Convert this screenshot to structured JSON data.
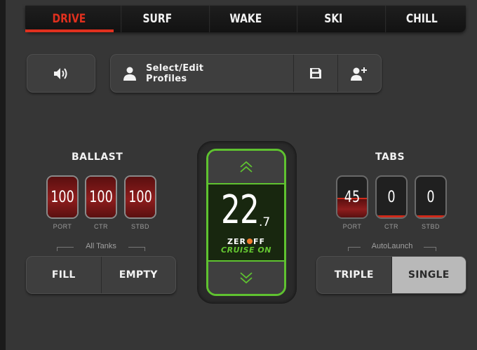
{
  "tabs": [
    {
      "label": "DRIVE",
      "active": true
    },
    {
      "label": "SURF",
      "active": false
    },
    {
      "label": "WAKE",
      "active": false
    },
    {
      "label": "SKI",
      "active": false
    },
    {
      "label": "CHILL",
      "active": false
    }
  ],
  "toolbar": {
    "volume_icon": "speaker-volume-icon",
    "profiles_label": "Select/Edit\nProfiles",
    "profile_icon": "user-icon",
    "save_icon": "save-icon",
    "add_user_icon": "add-user-icon"
  },
  "ballast": {
    "title": "BALLAST",
    "tanks": [
      {
        "label": "PORT",
        "value": "100",
        "fill": 1.0
      },
      {
        "label": "CTR",
        "value": "100",
        "fill": 1.0
      },
      {
        "label": "STBD",
        "value": "100",
        "fill": 1.0
      }
    ],
    "group_label": "All Tanks",
    "fill_label": "FILL",
    "empty_label": "EMPTY"
  },
  "speed": {
    "integer": "22",
    "decimal": ".7",
    "brand": "ZEROOFF",
    "status": "CRUISE ON",
    "up_icon": "double-chevron-up-icon",
    "down_icon": "double-chevron-down-icon"
  },
  "tabs_control": {
    "title": "TABS",
    "tabs": [
      {
        "label": "PORT",
        "value": "45",
        "fill": 0.45
      },
      {
        "label": "CTR",
        "value": "0",
        "fill": 0
      },
      {
        "label": "STBD",
        "value": "0",
        "fill": 0
      }
    ],
    "group_label": "AutoLaunch",
    "triple_label": "TRIPLE",
    "single_label": "SINGLE",
    "selected": "SINGLE"
  },
  "colors": {
    "accent_red": "#e0301e",
    "cruise_green": "#5fc230",
    "brand_orange": "#f07a2a"
  }
}
